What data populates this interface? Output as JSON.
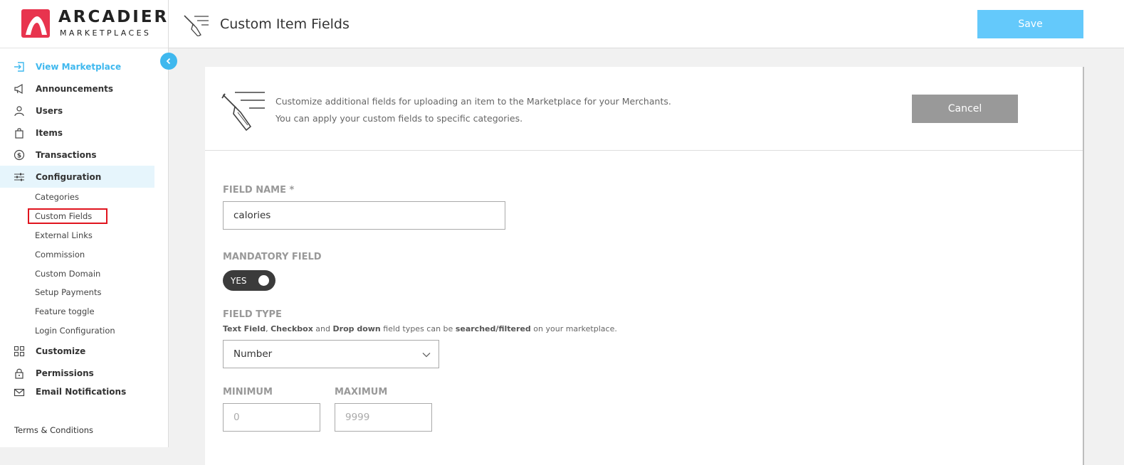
{
  "logo": {
    "word": "ARCADIER",
    "sub": "MARKETPLACES"
  },
  "sidebar": {
    "items": [
      {
        "label": "View Marketplace",
        "icon": "enter-icon"
      },
      {
        "label": "Announcements",
        "icon": "megaphone-icon"
      },
      {
        "label": "Users",
        "icon": "user-icon"
      },
      {
        "label": "Items",
        "icon": "bag-icon"
      },
      {
        "label": "Transactions",
        "icon": "dollar-icon"
      },
      {
        "label": "Configuration",
        "icon": "sliders-icon"
      }
    ],
    "sub_items": [
      "Categories",
      "Custom Fields",
      "External Links",
      "Commission",
      "Custom Domain",
      "Setup Payments",
      "Feature toggle",
      "Login Configuration"
    ],
    "items_after": [
      {
        "label": "Customize",
        "icon": "grid-icon"
      },
      {
        "label": "Permissions",
        "icon": "lock-icon"
      },
      {
        "label": "Email Notifications",
        "icon": "mail-icon"
      }
    ],
    "terms": "Terms & Conditions"
  },
  "header": {
    "title": "Custom Item Fields",
    "save_label": "Save"
  },
  "card": {
    "desc_line1": "Customize additional fields for uploading an item to the Marketplace for your Merchants.",
    "desc_line2": "You can apply your custom fields to specific categories.",
    "cancel_label": "Cancel"
  },
  "form": {
    "field_name_label": "FIELD NAME *",
    "field_name_value": "calories",
    "mandatory_label": "MANDATORY FIELD",
    "mandatory_toggle": "YES",
    "field_type_label": "FIELD TYPE",
    "hint": {
      "t1": "Text Field",
      "t2": ", ",
      "t3": "Checkbox",
      "t4": " and ",
      "t5": "Drop down",
      "t6": " field types can be ",
      "t7": "searched/filtered",
      "t8": " on your marketplace."
    },
    "field_type_value": "Number",
    "minimum_label": "MINIMUM",
    "minimum_placeholder": "0",
    "maximum_label": "MAXIMUM",
    "maximum_placeholder": "9999"
  },
  "colors": {
    "accent": "#3fb8ee",
    "save_button": "#64c9fb",
    "cancel_button": "#999999",
    "brand_red": "#e8344e",
    "highlight_box": "#e0141e"
  }
}
